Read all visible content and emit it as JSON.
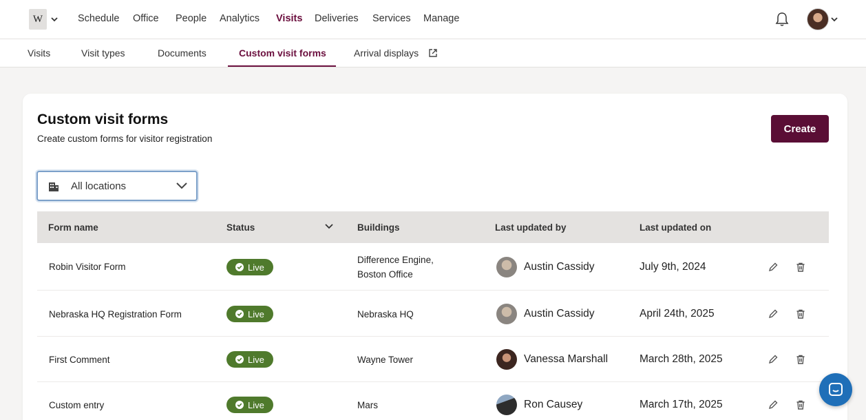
{
  "nav": {
    "logo_text": "W",
    "items": [
      "Schedule",
      "Office",
      "People",
      "Analytics",
      "Visits",
      "Deliveries",
      "Services",
      "Manage"
    ],
    "active": "Visits"
  },
  "subnav": {
    "items": [
      "Visits",
      "Visit types",
      "Documents",
      "Custom visit forms",
      "Arrival displays"
    ],
    "active": "Custom visit forms"
  },
  "page": {
    "title": "Custom visit forms",
    "subtitle": "Create custom forms for visitor registration",
    "create_label": "Create"
  },
  "location_filter": {
    "value": "All locations"
  },
  "table": {
    "headers": [
      "Form name",
      "Status",
      "Buildings",
      "Last updated by",
      "Last updated on"
    ],
    "rows": [
      {
        "name": "Robin Visitor Form",
        "status": "Live",
        "buildings": [
          "Difference Engine,",
          "Boston Office"
        ],
        "updated_by": "Austin Cassidy",
        "updated_on": "July 9th, 2024"
      },
      {
        "name": "Nebraska HQ Registration Form",
        "status": "Live",
        "buildings": [
          "Nebraska HQ"
        ],
        "updated_by": "Austin Cassidy",
        "updated_on": "April 24th, 2025"
      },
      {
        "name": "First Comment",
        "status": "Live",
        "buildings": [
          "Wayne Tower"
        ],
        "updated_by": "Vanessa Marshall",
        "updated_on": "March 28th, 2025"
      },
      {
        "name": "Custom entry",
        "status": "Live",
        "buildings": [
          "Mars"
        ],
        "updated_by": "Ron Causey",
        "updated_on": "March 17th, 2025"
      }
    ]
  },
  "colors": {
    "brand": "#5a0e35",
    "live": "#4f7a2c",
    "chat": "#1f6fb8"
  }
}
